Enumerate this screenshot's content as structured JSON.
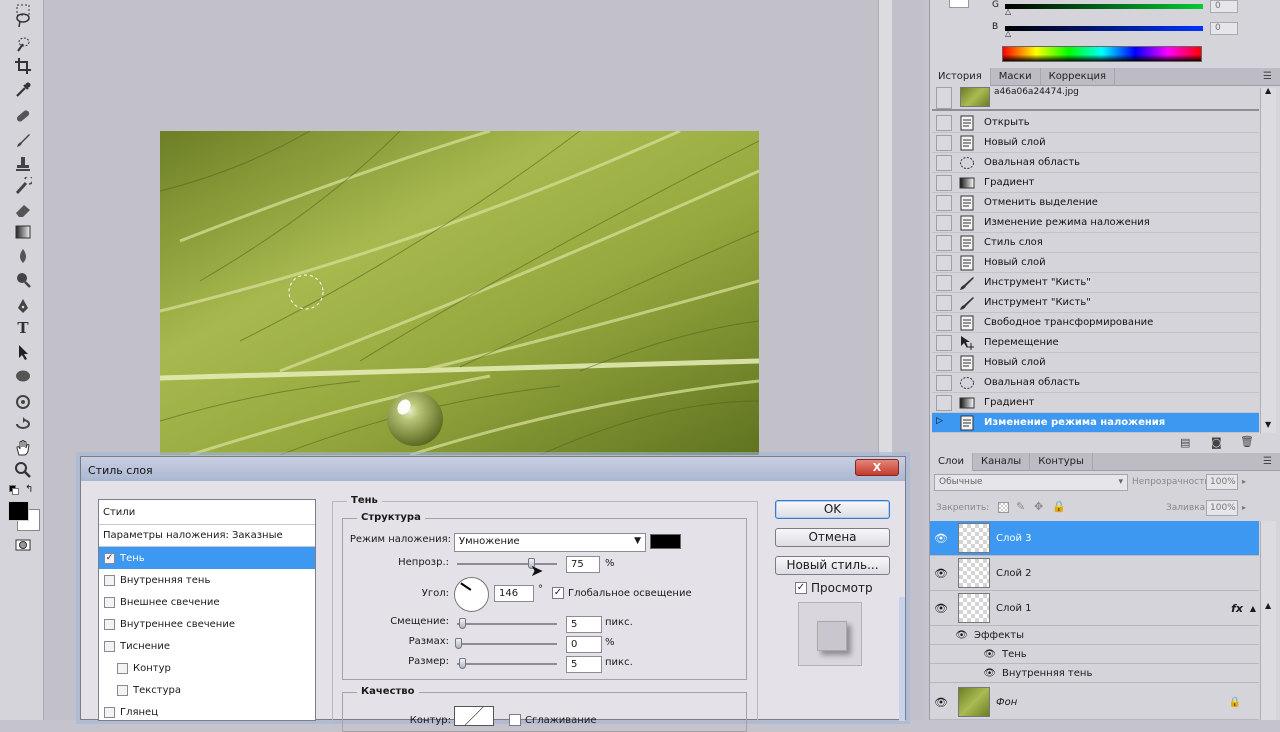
{
  "history_panel": {
    "tabs": [
      "История",
      "Маски",
      "Коррекция"
    ],
    "snapshot_name": "a46a06a24474.jpg",
    "items": [
      {
        "label": "Открыть",
        "icon": "doc-icon"
      },
      {
        "label": "Новый слой",
        "icon": "doc-icon"
      },
      {
        "label": "Овальная область",
        "icon": "ellipse-marquee-icon"
      },
      {
        "label": "Градиент",
        "icon": "gradient-icon"
      },
      {
        "label": "Отменить выделение",
        "icon": "doc-icon"
      },
      {
        "label": "Изменение режима наложения",
        "icon": "doc-icon"
      },
      {
        "label": "Стиль слоя",
        "icon": "doc-icon"
      },
      {
        "label": "Новый слой",
        "icon": "doc-icon"
      },
      {
        "label": "Инструмент \"Кисть\"",
        "icon": "brush-icon"
      },
      {
        "label": "Инструмент \"Кисть\"",
        "icon": "brush-icon"
      },
      {
        "label": "Свободное трансформирование",
        "icon": "doc-icon"
      },
      {
        "label": "Перемещение",
        "icon": "move-icon"
      },
      {
        "label": "Новый слой",
        "icon": "doc-icon"
      },
      {
        "label": "Овальная область",
        "icon": "ellipse-marquee-icon"
      },
      {
        "label": "Градиент",
        "icon": "gradient-icon"
      },
      {
        "label": "Изменение режима наложения",
        "icon": "doc-icon"
      }
    ]
  },
  "color_panel": {
    "g_label": "G",
    "g_value": "0",
    "b_label": "B",
    "b_value": "0"
  },
  "layers_panel": {
    "tabs": [
      "Слои",
      "Каналы",
      "Контуры"
    ],
    "blend_mode": "Обычные",
    "opacity_label": "Непрозрачность:",
    "opacity_value": "100%",
    "lock_label": "Закрепить:",
    "fill_label": "Заливка:",
    "fill_value": "100%",
    "layers": [
      {
        "name": "Слой 3",
        "selected": true
      },
      {
        "name": "Слой 2",
        "selected": false
      },
      {
        "name": "Слой 1",
        "selected": false,
        "fx": "fx"
      }
    ],
    "effects_label": "Эффекты",
    "effects": [
      "Тень",
      "Внутренняя тень"
    ],
    "background_layer": "Фон"
  },
  "dialog": {
    "title": "Стиль слоя",
    "close_label": "X",
    "styles_header": "Стили",
    "blending_options": "Параметры наложения: Заказные",
    "style_items": [
      {
        "label": "Тень",
        "checked": true,
        "indent": false
      },
      {
        "label": "Внутренняя тень",
        "checked": false,
        "indent": false
      },
      {
        "label": "Внешнее свечение",
        "checked": false,
        "indent": false
      },
      {
        "label": "Внутреннее свечение",
        "checked": false,
        "indent": false
      },
      {
        "label": "Тиснение",
        "checked": false,
        "indent": false
      },
      {
        "label": "Контур",
        "checked": false,
        "indent": true
      },
      {
        "label": "Текстура",
        "checked": false,
        "indent": true
      },
      {
        "label": "Глянец",
        "checked": false,
        "indent": false
      }
    ],
    "section_title": "Тень",
    "structure_title": "Структура",
    "blend_mode_label": "Режим наложения:",
    "blend_mode_value": "Умножение",
    "opacity_label": "Непрозр.:",
    "opacity_value": "75",
    "opacity_level": 0.75,
    "percent": "%",
    "angle_label": "Угол:",
    "angle_value": "146",
    "degree": "°",
    "global_light_label": "Глобальное освещение",
    "distance_label": "Смещение:",
    "distance_value": "5",
    "spread_label": "Размах:",
    "spread_value": "0",
    "size_label": "Размер:",
    "size_value": "5",
    "px_unit": "пикс.",
    "quality_title": "Качество",
    "contour_label": "Контур:",
    "antialias_label": "Сглаживание",
    "ok_label": "OK",
    "cancel_label": "Отмена",
    "new_style_label": "Новый стиль...",
    "preview_label": "Просмотр",
    "shadow_color": "#000000"
  },
  "colors": {
    "accent": "#3c98f0",
    "leaf_dark": "#5d6f1c",
    "leaf_light": "#b9c864"
  }
}
